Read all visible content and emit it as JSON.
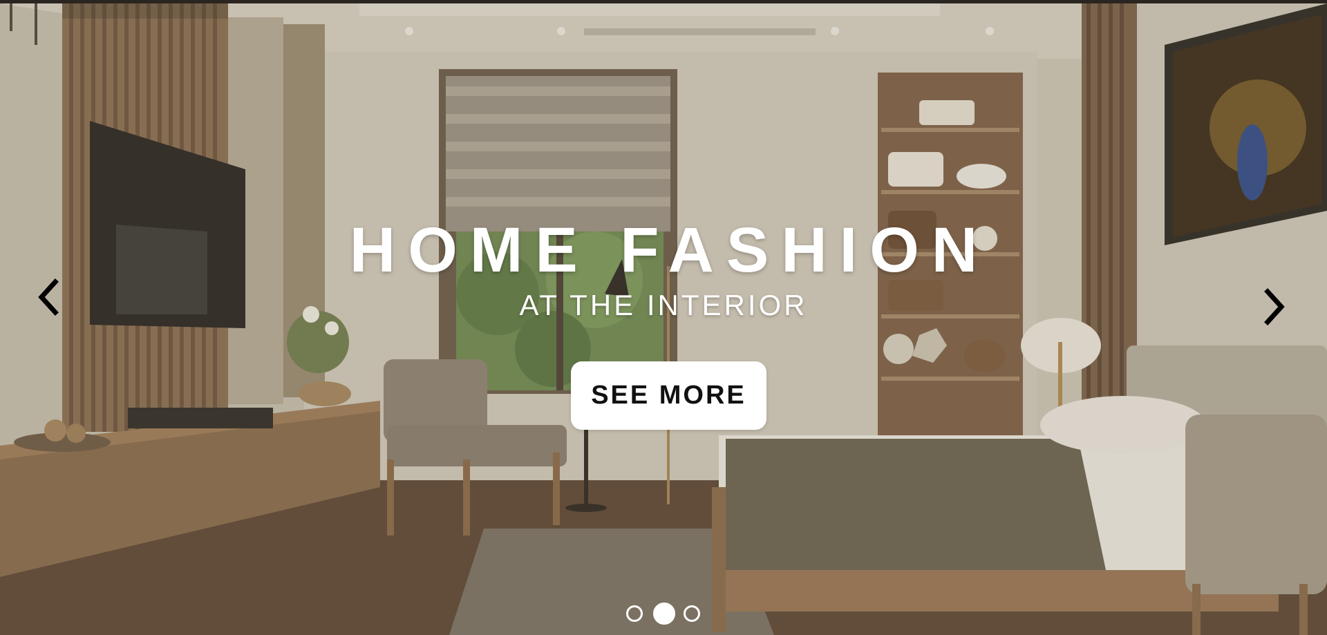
{
  "hero": {
    "headline": "HOME FASHION",
    "subheadline": "AT THE INTERIOR",
    "cta_label": "SEE MORE"
  },
  "carousel": {
    "prev_icon": "chevron-left-icon",
    "next_icon": "chevron-right-icon",
    "slide_count": 3,
    "active_slide": 2
  },
  "colors": {
    "overlay": "#786e5a",
    "text": "#ffffff",
    "button_bg": "#ffffff",
    "button_text": "#111111",
    "arrow": "#000000"
  }
}
